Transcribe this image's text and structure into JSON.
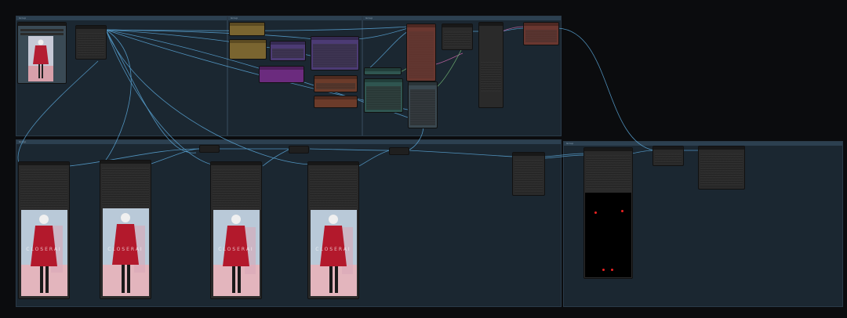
{
  "window": {
    "background": "#0b0c0e"
  },
  "groups": [
    {
      "id": "g1",
      "label": "Group"
    },
    {
      "id": "g2",
      "label": "Group"
    },
    {
      "id": "g3",
      "label": "Group"
    },
    {
      "id": "g4",
      "label": "Group"
    },
    {
      "id": "g5",
      "label": "Group"
    }
  ],
  "colors": {
    "wire": "#5aa5d6",
    "wire_pink": "#d36ab0",
    "wire_green": "#7ac27a",
    "node_default": "#2a2a2a",
    "node_yellow": "#7a6530",
    "node_purple": "#4c3b74",
    "node_magenta": "#6b2b7e",
    "node_red": "#6a3730",
    "node_teal": "#2f5550",
    "node_orange": "#6b3b2a"
  },
  "preview_images": [
    {
      "name": "source-image",
      "subject": "woman-red-coat"
    },
    {
      "name": "output-image-1",
      "subject": "woman-red-coat"
    },
    {
      "name": "output-image-2",
      "subject": "woman-red-coat"
    },
    {
      "name": "output-image-3",
      "subject": "woman-red-coat"
    },
    {
      "name": "output-image-4",
      "subject": "woman-red-coat"
    }
  ],
  "pose_preview": {
    "points": 4
  }
}
